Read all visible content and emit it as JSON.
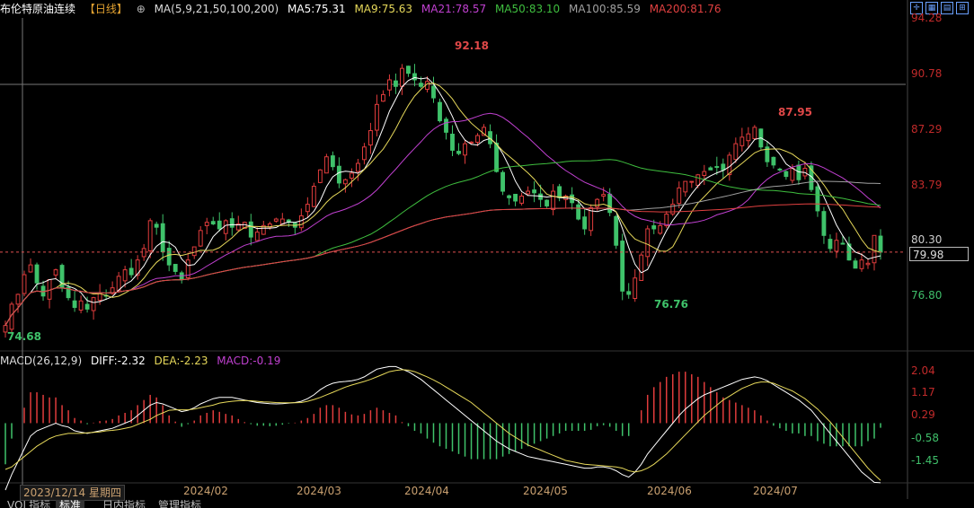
{
  "header": {
    "title": "布伦特原油连续",
    "period": "【日线】",
    "ma_label": "MA(5,9,21,50,100,200)",
    "ma5": "MA5:75.31",
    "ma9": "MA9:75.63",
    "ma21": "MA21:78.57",
    "ma50": "MA50:83.10",
    "ma100": "MA100:85.59",
    "ma200": "MA200:81.76"
  },
  "colors": {
    "up": "#e03c3c",
    "down": "#3fc26a",
    "ma5": "#ffffff",
    "ma9": "#e6d85a",
    "ma21": "#c040d0",
    "ma50": "#3fbf3f",
    "ma100": "#a0a0a0",
    "ma200": "#e04040"
  },
  "price_axis": {
    "ticks": [
      "94.28",
      "90.78",
      "87.29",
      "83.79",
      "80.30",
      "76.80"
    ],
    "current_price": "79.98"
  },
  "annotations": {
    "high": "92.18",
    "high2": "87.95",
    "low": "76.76",
    "low_start": "74.68"
  },
  "macd": {
    "label": "MACD(26,12,9)",
    "diff": "DIFF:-2.32",
    "dea": "DEA:-2.23",
    "macd": "MACD:-0.19",
    "ticks": [
      "2.04",
      "1.17",
      "0.29",
      "-0.58",
      "-1.45"
    ]
  },
  "x_axis": {
    "cursor_date": "2023/12/14 星期四",
    "months": [
      "2024/02",
      "2024/03",
      "2024/04",
      "2024/05",
      "2024/06",
      "2024/07"
    ]
  },
  "tabs": [
    "VOL指标",
    "标准",
    "日内指标",
    "管理指标"
  ],
  "chart_data": {
    "type": "candlestick",
    "title": "布伦特原油连续",
    "ylim": [
      74.0,
      94.28
    ],
    "x_months": [
      "2024/02",
      "2024/03",
      "2024/04",
      "2024/05",
      "2024/06",
      "2024/07"
    ],
    "series": [
      {
        "name": "MA5",
        "value": 75.31
      },
      {
        "name": "MA9",
        "value": 75.63
      },
      {
        "name": "MA21",
        "value": 78.57
      },
      {
        "name": "MA50",
        "value": 83.1
      },
      {
        "name": "MA100",
        "value": 85.59
      },
      {
        "name": "MA200",
        "value": 81.76
      }
    ],
    "closes": [
      75.5,
      76.8,
      77.4,
      78.6,
      79.2,
      78.1,
      77.3,
      78.3,
      78.9,
      77.8,
      77.2,
      76.6,
      77.0,
      76.5,
      77.2,
      77.5,
      77.3,
      77.8,
      78.5,
      78.9,
      78.6,
      79.5,
      80.2,
      81.9,
      81.5,
      80.0,
      79.2,
      78.8,
      78.3,
      79.5,
      80.3,
      81.3,
      81.8,
      81.7,
      81.4,
      81.9,
      81.5,
      81.7,
      81.8,
      80.9,
      81.2,
      81.6,
      81.7,
      82.0,
      82.0,
      81.8,
      81.5,
      82.2,
      82.9,
      84.0,
      85.0,
      85.8,
      85.2,
      84.2,
      84.4,
      84.8,
      85.4,
      86.4,
      87.4,
      89.0,
      89.6,
      90.5,
      90.1,
      91.2,
      90.9,
      90.5,
      90.1,
      90.4,
      89.4,
      88.0,
      87.3,
      86.2,
      86.0,
      86.6,
      86.7,
      87.1,
      87.6,
      86.6,
      84.9,
      83.7,
      83.3,
      83.1,
      83.4,
      83.7,
      83.6,
      83.2,
      82.8,
      83.7,
      83.3,
      83.4,
      83.0,
      82.0,
      81.4,
      82.7,
      83.2,
      83.5,
      82.4,
      80.4,
      77.6,
      77.4,
      78.4,
      79.8,
      81.4,
      81.4,
      81.6,
      82.3,
      82.9,
      83.9,
      84.3,
      84.3,
      84.7,
      84.9,
      85.0,
      85.2,
      85.0,
      85.9,
      86.6,
      87.0,
      87.2,
      87.6,
      86.4,
      85.5,
      85.3,
      85.0,
      84.6,
      85.1,
      84.4,
      85.1,
      83.8,
      82.5,
      81.0,
      80.2,
      80.7,
      80.5,
      79.5,
      79.0,
      79.5,
      79.3,
      81.0,
      79.98
    ],
    "macd_diff": [
      -2.6,
      -2.0,
      -1.5,
      -1.0,
      -0.5,
      -0.3,
      -0.2,
      -0.1,
      0.0,
      -0.1,
      -0.15,
      -0.3,
      -0.35,
      -0.4,
      -0.35,
      -0.3,
      -0.25,
      -0.2,
      -0.1,
      0.0,
      0.1,
      0.3,
      0.5,
      0.7,
      0.8,
      0.75,
      0.65,
      0.55,
      0.45,
      0.5,
      0.6,
      0.75,
      0.85,
      0.95,
      1.0,
      1.0,
      1.0,
      0.95,
      0.9,
      0.85,
      0.8,
      0.78,
      0.76,
      0.75,
      0.76,
      0.78,
      0.8,
      0.85,
      0.95,
      1.1,
      1.3,
      1.45,
      1.55,
      1.6,
      1.62,
      1.65,
      1.7,
      1.8,
      1.95,
      2.1,
      2.15,
      2.2,
      2.2,
      2.1,
      2.0,
      1.85,
      1.7,
      1.5,
      1.3,
      1.1,
      0.9,
      0.7,
      0.5,
      0.3,
      0.1,
      -0.1,
      -0.3,
      -0.5,
      -0.7,
      -0.85,
      -1.0,
      -1.1,
      -1.2,
      -1.3,
      -1.35,
      -1.4,
      -1.45,
      -1.5,
      -1.55,
      -1.6,
      -1.65,
      -1.7,
      -1.75,
      -1.75,
      -1.7,
      -1.7,
      -1.75,
      -1.85,
      -2.0,
      -2.1,
      -1.9,
      -1.6,
      -1.2,
      -0.9,
      -0.6,
      -0.3,
      0.0,
      0.3,
      0.55,
      0.75,
      0.95,
      1.1,
      1.2,
      1.3,
      1.4,
      1.5,
      1.6,
      1.7,
      1.75,
      1.8,
      1.75,
      1.65,
      1.5,
      1.35,
      1.2,
      1.05,
      0.9,
      0.7,
      0.5,
      0.2,
      -0.1,
      -0.4,
      -0.7,
      -1.0,
      -1.3,
      -1.6,
      -1.9,
      -2.1,
      -2.3,
      -2.32
    ],
    "macd_dea": [
      -1.8,
      -1.7,
      -1.5,
      -1.3,
      -1.1,
      -0.9,
      -0.75,
      -0.6,
      -0.5,
      -0.45,
      -0.4,
      -0.4,
      -0.4,
      -0.38,
      -0.36,
      -0.34,
      -0.3,
      -0.28,
      -0.25,
      -0.2,
      -0.15,
      -0.05,
      0.05,
      0.15,
      0.3,
      0.4,
      0.5,
      0.52,
      0.52,
      0.52,
      0.55,
      0.6,
      0.65,
      0.7,
      0.78,
      0.82,
      0.85,
      0.87,
      0.88,
      0.87,
      0.85,
      0.83,
      0.82,
      0.8,
      0.79,
      0.79,
      0.79,
      0.8,
      0.85,
      0.92,
      1.0,
      1.1,
      1.2,
      1.3,
      1.4,
      1.48,
      1.55,
      1.62,
      1.7,
      1.8,
      1.9,
      2.0,
      2.05,
      2.08,
      2.06,
      2.0,
      1.9,
      1.8,
      1.68,
      1.55,
      1.4,
      1.25,
      1.1,
      0.95,
      0.8,
      0.6,
      0.4,
      0.2,
      0.0,
      -0.2,
      -0.4,
      -0.55,
      -0.7,
      -0.85,
      -0.95,
      -1.05,
      -1.15,
      -1.25,
      -1.35,
      -1.45,
      -1.5,
      -1.55,
      -1.6,
      -1.62,
      -1.64,
      -1.66,
      -1.68,
      -1.7,
      -1.75,
      -1.85,
      -1.9,
      -1.85,
      -1.75,
      -1.6,
      -1.4,
      -1.2,
      -0.95,
      -0.7,
      -0.45,
      -0.2,
      0.05,
      0.3,
      0.5,
      0.7,
      0.9,
      1.05,
      1.2,
      1.35,
      1.45,
      1.55,
      1.6,
      1.6,
      1.55,
      1.45,
      1.35,
      1.25,
      1.1,
      0.95,
      0.75,
      0.55,
      0.3,
      0.05,
      -0.25,
      -0.55,
      -0.85,
      -1.15,
      -1.45,
      -1.75,
      -2.0,
      -2.23
    ]
  }
}
